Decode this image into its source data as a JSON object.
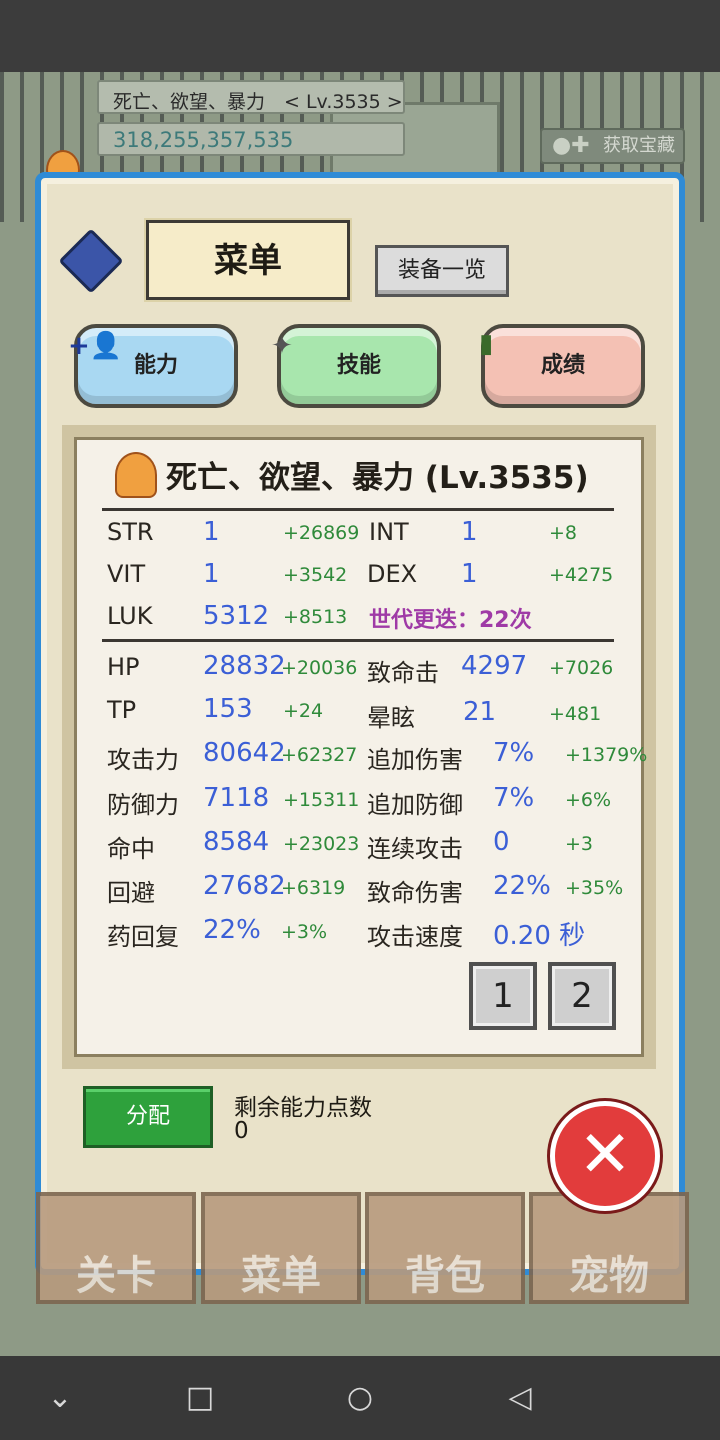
{
  "hud": {
    "name_level": "死亡、欲望、暴力　< Lv.3535 >",
    "gold": "318,255,357,535",
    "get_treasure": "获取宝藏"
  },
  "menu": {
    "title": "菜单",
    "equip_list": "装备一览"
  },
  "tabs": [
    {
      "label": "能力"
    },
    {
      "label": "技能"
    },
    {
      "label": "成绩"
    }
  ],
  "card": {
    "title": "死亡、欲望、暴力 (Lv.3535)"
  },
  "stats": {
    "str": {
      "label": "STR",
      "val": "1",
      "bonus": "+26869"
    },
    "int": {
      "label": "INT",
      "val": "1",
      "bonus": "+8"
    },
    "vit": {
      "label": "VIT",
      "val": "1",
      "bonus": "+3542"
    },
    "dex": {
      "label": "DEX",
      "val": "1",
      "bonus": "+4275"
    },
    "luk": {
      "label": "LUK",
      "val": "5312",
      "bonus": "+8513"
    },
    "generation": "世代更迭：22次",
    "hp": {
      "label": "HP",
      "val": "28832",
      "bonus": "+20036"
    },
    "crit": {
      "label": "致命击",
      "val": "4297",
      "bonus": "+7026"
    },
    "tp": {
      "label": "TP",
      "val": "153",
      "bonus": "+24"
    },
    "stun": {
      "label": "晕眩",
      "val": "21",
      "bonus": "+481"
    },
    "atk": {
      "label": "攻击力",
      "val": "80642",
      "bonus": "+62327"
    },
    "extradmg": {
      "label": "追加伤害",
      "val": "7%",
      "bonus": "+1379%"
    },
    "def": {
      "label": "防御力",
      "val": "7118",
      "bonus": "+15311"
    },
    "extradef": {
      "label": "追加防御",
      "val": "7%",
      "bonus": "+6%"
    },
    "hit": {
      "label": "命中",
      "val": "8584",
      "bonus": "+23023"
    },
    "combo": {
      "label": "连续攻击",
      "val": "0",
      "bonus": "+3"
    },
    "eva": {
      "label": "回避",
      "val": "27682",
      "bonus": "+6319"
    },
    "critdmg": {
      "label": "致命伤害",
      "val": "22%",
      "bonus": "+35%"
    },
    "potion": {
      "label": "药回复",
      "val": "22%",
      "bonus": "+3%"
    },
    "atkspd": {
      "label": "攻击速度",
      "val": "0.20 秒"
    }
  },
  "pages": [
    "1",
    "2"
  ],
  "allot": {
    "button": "分配",
    "remaining_label": "剩余能力点数",
    "remaining_value": "0"
  },
  "bottom_nav": [
    "关卡",
    "菜单",
    "背包",
    "宠物"
  ]
}
